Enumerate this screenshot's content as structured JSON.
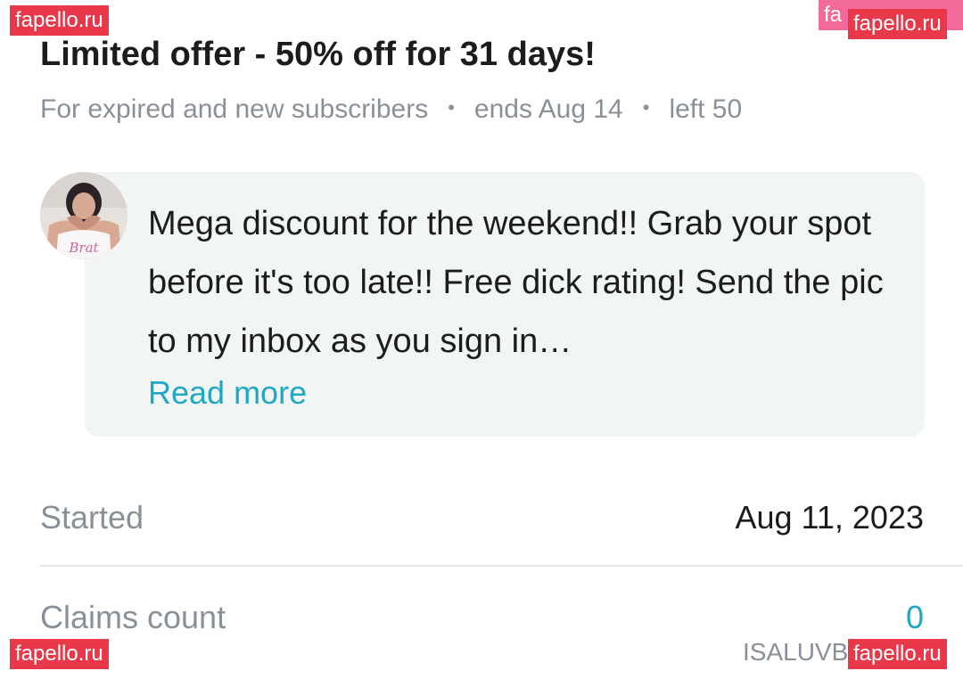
{
  "offer": {
    "title": "Limited offer - 50% off for 31 days!",
    "audience": "For expired and new subscribers",
    "ends": "ends Aug 14",
    "left": "left 50",
    "separator": "•"
  },
  "post": {
    "avatar_caption": "Brat",
    "message": "Mega discount for the weekend!! Grab your spot before it's too late!! Free dick rating! Send the pic to my inbox as you sign in…",
    "read_more": "Read more"
  },
  "details": {
    "started_label": "Started",
    "started_value": "Aug 11, 2023",
    "claims_label": "Claims count",
    "claims_value": "0"
  },
  "username_partial": "ISALUVB",
  "watermarks": {
    "text": "fapello.ru",
    "partial": "fa"
  },
  "colors": {
    "accent": "#1fa7c4",
    "muted": "#8a9099",
    "bubble": "#f1f5f4",
    "watermark": "#e8384a"
  }
}
